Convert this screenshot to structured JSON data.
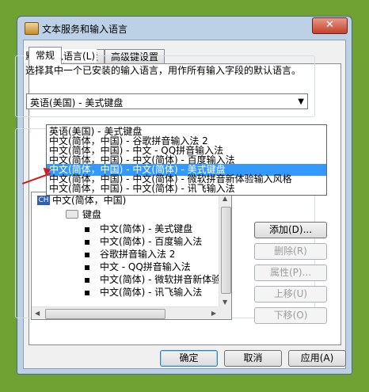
{
  "window": {
    "title": "文本服务和输入语言",
    "close_label": "✕"
  },
  "tabs": [
    {
      "label": "常规"
    },
    {
      "label": "语言栏"
    },
    {
      "label": "高级键设置"
    }
  ],
  "default_language": {
    "group_title": "默认输入语言(L)",
    "description": "选择其中一个已安装的输入语言，用作所有输入字段的默认语言。",
    "selected": "英语(美国) - 美式键盘",
    "options": [
      "英语(美国) - 美式键盘",
      "中文(简体，中国) - 谷歌拼音输入法 2",
      "中文(简体，中国) - 中文 - QQ拼音输入法",
      "中文(简体，中国) - 中文(简体) - 百度输入法",
      "中文(简体，中国) - 中文(简体) - 美式键盘",
      "中文(简体，中国) - 中文(简体) - 微软拼音新体验输入风格",
      "中文(简体，中国) - 中文(简体) - 讯飞输入法"
    ],
    "highlighted_index": 4
  },
  "tree": {
    "language_badge": "CH",
    "language": "中文(简体，中国)",
    "category": "键盘",
    "items": [
      "中文(简体) - 美式键盘",
      "中文(简体) - 百度输入法",
      "谷歌拼音输入法 2",
      "中文 - QQ拼音输入法",
      "中文(简体) - 微软拼音新体验输",
      "中文(简体) - 讯飞输入法"
    ]
  },
  "side_buttons": {
    "add": "添加(D)...",
    "remove": "删除(R)",
    "properties": "属性(P)...",
    "move_up": "上移(U)",
    "move_down": "下移(O)"
  },
  "footer": {
    "ok": "确定",
    "cancel": "取消",
    "apply": "应用(A)"
  },
  "colors": {
    "highlight": "#3399ff",
    "annotation_arrow": "#d01c1c",
    "desktop": "#6fa232"
  }
}
